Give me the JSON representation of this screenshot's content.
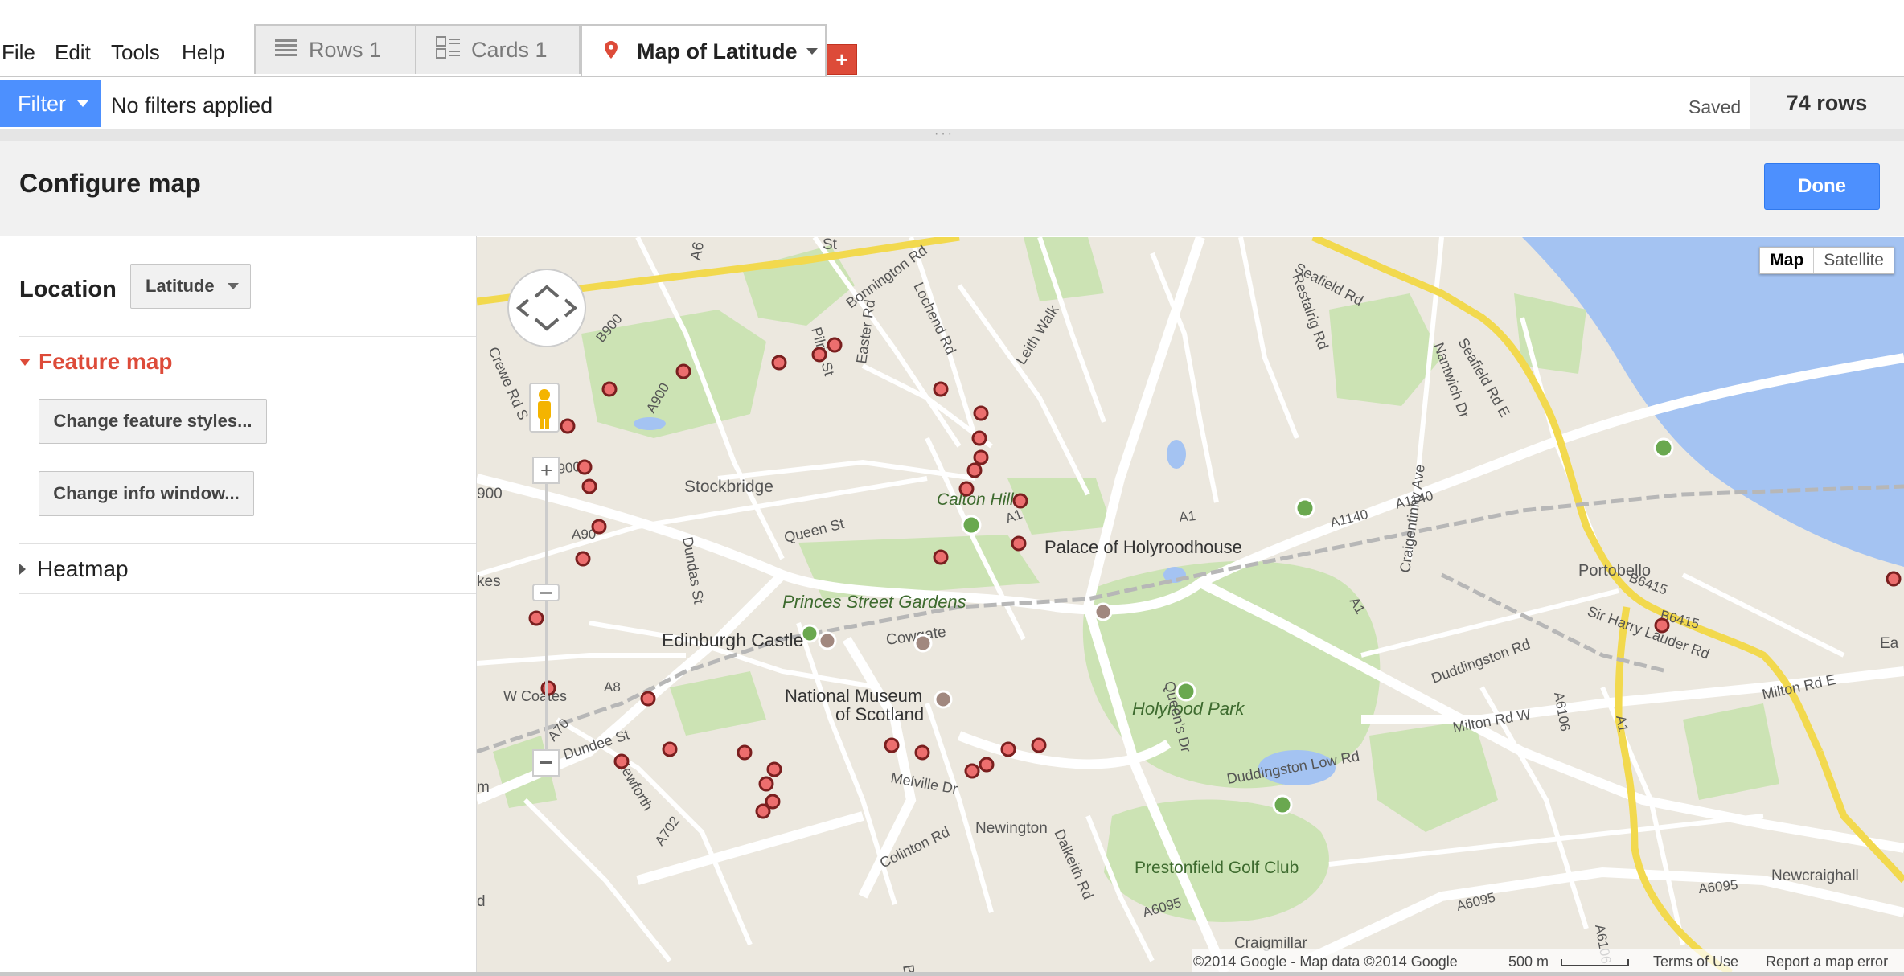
{
  "menu": [
    "File",
    "Edit",
    "Tools",
    "Help"
  ],
  "tabs": [
    {
      "label": "Rows 1",
      "icon": "rows-icon"
    },
    {
      "label": "Cards 1",
      "icon": "cards-icon"
    },
    {
      "label": "Map of Latitude",
      "icon": "map-pin-icon",
      "active": true
    }
  ],
  "add_tab_label": "+",
  "filter": {
    "button_label": "Filter",
    "status": "No filters applied",
    "saved": "Saved",
    "row_count": "74 rows"
  },
  "configure": {
    "title": "Configure map",
    "done_label": "Done"
  },
  "side": {
    "location_label": "Location",
    "location_value": "Latitude",
    "feature_map_label": "Feature map",
    "change_styles_label": "Change feature styles...",
    "change_info_label": "Change info window...",
    "heatmap_label": "Heatmap"
  },
  "map": {
    "type_map": "Map",
    "type_satellite": "Satellite",
    "labels": {
      "stockbridge": "Stockbridge",
      "calton_hill": "Calton Hill",
      "holyrood_palace": "Palace of Holyroodhouse",
      "princes_gardens": "Princes Street Gardens",
      "castle": "Edinburgh Castle",
      "cowgate": "Cowgate",
      "museum1": "National Museum",
      "museum2": "of Scotland",
      "holyrood_park": "Holyrood Park",
      "portobello": "Portobello",
      "newington": "Newington",
      "prestonfield": "Prestonfield Golf Club",
      "craigmillar": "Craigmillar",
      "newcraighall": "Newcraighall",
      "queen_st": "Queen St",
      "melville_dr": "Melville Dr",
      "leith_walk": "Leith Walk",
      "seafield_rd": "Seafield Rd",
      "seafield_rd_e": "Seafield Rd E",
      "duddingston_low_rd": "Duddingston Low Rd",
      "duddingston_rd": "Duddingston Rd",
      "milton_rd_e": "Milton Rd E",
      "milton_rd_w": "Milton Rd W",
      "queens_dr": "Queen's Dr",
      "colinton_rd": "Colinton Rd",
      "dalkeith_rd": "Dalkeith Rd",
      "w_coates": "W Coates",
      "dundee_st": "Dundee St",
      "viewforth": "Viewforth",
      "dundas_st": "Dundas St",
      "easter_rd": "Easter Rd",
      "lochend_rd": "Lochend Rd",
      "restalrig_rd": "Restalrig Rd",
      "craigentinny_ave": "Craigentinny Ave",
      "nantwich_dr": "Nantwich Dr",
      "pilrig_st": "Pilrig St",
      "bonnington_rd": "Bonnington Rd",
      "crewe_rd": "Crewe Rd S",
      "sir_harry": "Sir Harry Lauder Rd",
      "a1": "A1",
      "a1b": "A1",
      "a1c": "A1",
      "a1d": "A1",
      "a1140": "A1140",
      "a1140b": "A1140",
      "a8": "A8",
      "a70": "A70",
      "a90": "A90",
      "a900": "A900",
      "a702": "A702",
      "a6095": "A6095",
      "a6095b": "A6095",
      "a6095c": "A6095",
      "a6106": "A6106",
      "a6106b": "A6106",
      "b900": "B900",
      "b900b": "B900",
      "b6415": "B6415",
      "b6415b": "B6415",
      "cut_rd": "Rd",
      "cut_kes": "kes",
      "cut_m": "m",
      "cut_d": "d",
      "cut_900": "900",
      "cut_st": "St",
      "cut_bla": "Bla",
      "cut_ea": "Ea",
      "cut_a6": "A6"
    },
    "copyright": "©2014 Google - Map data ©2014 Google",
    "scale": "500 m",
    "terms": "Terms of Use",
    "report": "Report a map error"
  }
}
